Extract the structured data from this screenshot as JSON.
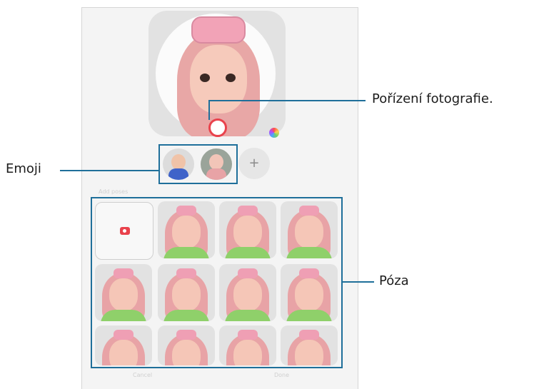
{
  "callouts": {
    "capture_photo": "Pořízení fotografie.",
    "emoji": "Emoji",
    "pose": "Póza"
  },
  "screen": {
    "poses_section_title": "Add poses",
    "add_emoji": "+",
    "cancel_label": "Cancel",
    "done_label": "Done"
  },
  "colors": {
    "accent": "#1f6f9a",
    "shutter": "#e9424c"
  }
}
